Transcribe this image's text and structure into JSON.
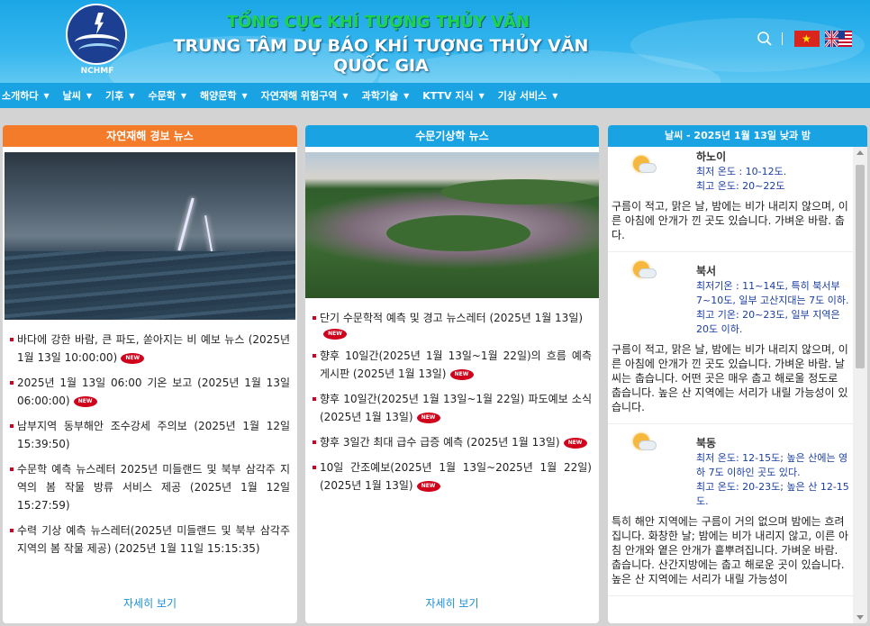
{
  "header": {
    "logo_text": "NCHMF",
    "title_top": "TỔNG CỤC KHÍ TƯỢNG THỦY VĂN",
    "title_main": "TRUNG TÂM DỰ BÁO KHÍ TƯỢNG THỦY VĂN QUỐC GIA",
    "flag_vn_star": "★"
  },
  "nav": {
    "items": [
      "소개하다",
      "날씨",
      "기후",
      "수문학",
      "해양문학",
      "자연재해 위험구역",
      "과학기술",
      "KTTV 지식",
      "기상 서비스"
    ],
    "caret": "▼"
  },
  "news_disaster": {
    "title": "자연재해 경보 뉴스",
    "items": [
      "바다에 강한 바람, 큰 파도, 쏟아지는 비 예보 뉴스 (2025년 1월 13일 10:00:00)",
      "2025년 1월 13일 06:00 기온 보고 (2025년 1월 13일 06:00:00)",
      "남부지역 동부해안 조수강세 주의보 (2025년 1월 12일 15:39:50)",
      "수문학 예측 뉴스레터 2025년 미들랜드 및 북부 삼각주 지역의 봄 작물 방류 서비스 제공 (2025년 1월 12일 15:27:59)",
      "수력 기상 예측 뉴스레터(2025년 미들랜드 및 북부 삼각주 지역의 봄 작물 제공) (2025년 1월 11일 15:15:35)"
    ],
    "more": "자세히 보기"
  },
  "news_hydro": {
    "title": "수문기상학 뉴스",
    "items": [
      "단기 수문학적 예측 및 경고 뉴스레터 (2025년 1월 13일)",
      "향후 10일간(2025년 1월 13일~1월 22일)의 흐름 예측 게시판 (2025년 1월 13일)",
      "향후 10일간(2025년 1월 13일~1월 22일) 파도예보 소식 (2025년 1월 13일)",
      "향후 3일간 최대 급수 급증 예측 (2025년 1월 13일)",
      "10일 간조예보(2025년 1월 13일~2025년 1월 22일) (2025년 1월 13일)"
    ],
    "more": "자세히 보기"
  },
  "new_badge": "NEW",
  "weather": {
    "title": "날씨 - 2025년 1월 13일 낮과 밤",
    "cities": [
      {
        "name": "하노이",
        "temp_lines": [
          "최저 온도 : 10-12도.",
          "최고 온도: 20~22도"
        ],
        "desc": "구름이 적고, 맑은 날, 밤에는 비가 내리지 않으며, 이른 아침에 안개가 낀 곳도 있습니다. 가벼운 바람. 춥다."
      },
      {
        "name": "북서",
        "temp_lines": [
          "최저기온 : 11~14도, 특히 북서부 7~10도, 일부 고산지대는 7도 이하.",
          "최고 기온: 20~23도, 일부 지역은 20도 이하."
        ],
        "desc": "구름이 적고, 맑은 날, 밤에는 비가 내리지 않으며, 이른 아침에 안개가 낀 곳도 있습니다. 가벼운 바람. 날씨는 춥습니다. 어떤 곳은 매우 춥고 해로울 정도로 춥습니다. 높은 산 지역에는 서리가 내릴 가능성이 있습니다."
      },
      {
        "name": "북동",
        "temp_lines": [
          "최저 온도: 12-15도; 높은 산에는 영하 7도 이하인 곳도 있다.",
          "최고 온도: 20-23도; 높은 산 12-15도."
        ],
        "desc": "특히 해안 지역에는 구름이 거의 없으며 밤에는 흐려집니다. 화창한 날; 밤에는 비가 내리지 않고, 이른 아침 안개와 옅은 안개가 흩뿌려집니다. 가벼운 바람. 춥습니다. 산간지방에는 춥고 해로운 곳이 있습니다. 높은 산 지역에는 서리가 내릴 가능성이"
      }
    ]
  },
  "colors": {
    "header_blue": "#1aa6e6",
    "nav_blue": "#1aa3e3",
    "orange_head": "#f37b2a",
    "title_green": "#1ed34c",
    "bullet_red": "#d0021b",
    "link_blue": "#1a8fd6",
    "temp_text": "#1a3da0"
  },
  "icons": [
    "nchmf-logo",
    "search-icon",
    "vietnam-flag-icon",
    "uk-us-flag-icon",
    "partly-cloudy-icon",
    "new-badge-icon"
  ]
}
